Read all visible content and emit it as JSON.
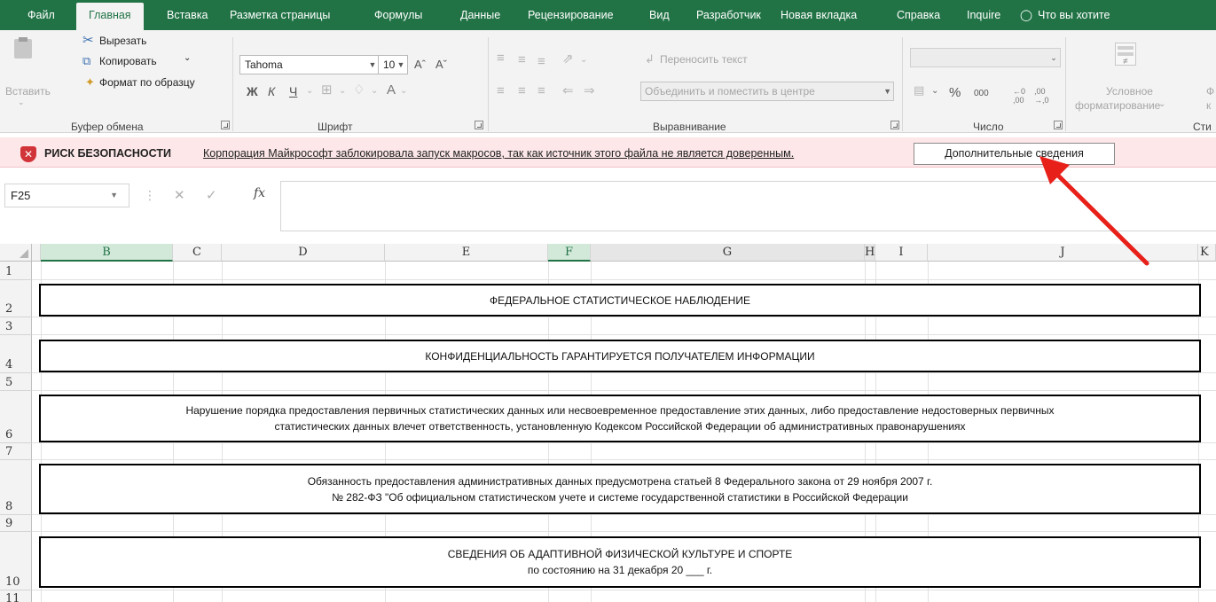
{
  "ribbon_tabs": [
    "Файл",
    "Главная",
    "Вставка",
    "Разметка страницы",
    "Формулы",
    "Данные",
    "Рецензирование",
    "Вид",
    "Разработчик",
    "Новая вкладка",
    "Справка",
    "Inquire",
    "Что вы хотите"
  ],
  "active_tab": "Главная",
  "clipboard": {
    "paste": "Вставить",
    "cut": "Вырезать",
    "copy": "Копировать",
    "format_painter": "Формат по образцу",
    "group_label": "Буфер обмена"
  },
  "font": {
    "family": "Tahoma",
    "size": "10",
    "group_label": "Шрифт"
  },
  "alignment": {
    "wrap_text": "Переносить текст",
    "merge_center": "Объединить и поместить в центре",
    "group_label": "Выравнивание"
  },
  "number": {
    "format_value": "",
    "percent": "%",
    "thousands": "000",
    "group_label": "Число"
  },
  "styles": {
    "conditional_line1": "Условное",
    "conditional_line2": "форматирование",
    "group_label": "Сти"
  },
  "security_bar": {
    "title": "РИСК БЕЗОПАСНОСТИ",
    "message": "Корпорация Майкрософт заблокировала запуск макросов, так как источник этого файла не является доверенным.",
    "button": "Дополнительные сведения"
  },
  "formula_bar": {
    "name_box": "F25",
    "fx": "fx",
    "value": ""
  },
  "columns": [
    "B",
    "C",
    "D",
    "E",
    "F",
    "G",
    "H",
    "I",
    "J",
    "K"
  ],
  "selected_columns": [
    "B",
    "F"
  ],
  "rows": [
    "1",
    "2",
    "3",
    "4",
    "5",
    "6",
    "7",
    "8",
    "9",
    "10",
    "11"
  ],
  "cells": {
    "row2": "ФЕДЕРАЛЬНОЕ СТАТИСТИЧЕСКОЕ НАБЛЮДЕНИЕ",
    "row4": "КОНФИДЕНЦИАЛЬНОСТЬ ГАРАНТИРУЕТСЯ ПОЛУЧАТЕЛЕМ ИНФОРМАЦИИ",
    "row6_line1": "Нарушение порядка предоставления первичных статистических данных или несвоевременное предоставление этих данных, либо предоставление недостоверных первичных",
    "row6_line2": "статистических данных влечет ответственность, установленную Кодексом Российской Федерации об административных правонарушениях",
    "row8_line1": "Обязанность предоставления административных данных предусмотрена статьей 8 Федерального закона от 29 ноября 2007 г.",
    "row8_line2": "№ 282-ФЗ \"Об официальном статистическом учете и системе государственной статистики в Российской Федерации",
    "row10_line1": "СВЕДЕНИЯ ОБ АДАПТИВНОЙ ФИЗИЧЕСКОЙ КУЛЬТУРЕ И СПОРТЕ",
    "row10_line2": "по состоянию на 31 декабря 20 ___ г."
  },
  "colors": {
    "excel_green": "#217346",
    "security_bg": "#fde7e9",
    "shield_red": "#d13438",
    "annotation_arrow": "#e8201a"
  },
  "icons": [
    "cut-icon",
    "copy-icon",
    "format-painter-icon",
    "paste-icon",
    "shield-x-icon",
    "lightbulb-icon",
    "cancel-icon",
    "enter-icon"
  ]
}
